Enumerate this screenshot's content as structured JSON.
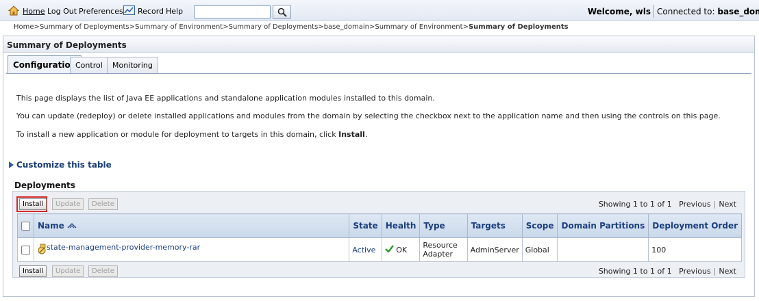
{
  "toolbar": {
    "home": "Home",
    "logout": "Log Out",
    "preferences": "Preferences",
    "record": "Record",
    "help": "Help",
    "search_value": "",
    "welcome": "Welcome, wls",
    "connected_label": "Connected to:",
    "domain": "base_domain"
  },
  "breadcrumb": {
    "items": [
      "Home",
      "Summary of Deployments",
      "Summary of Environment",
      "Summary of Deployments",
      "base_domain",
      "Summary of Environment"
    ],
    "separator": ">",
    "current": "Summary of Deployments"
  },
  "panel": {
    "title": "Summary of Deployments",
    "tabs": [
      "Configuration",
      "Control",
      "Monitoring"
    ],
    "active_tab": "Configuration"
  },
  "intro": {
    "line1": "This page displays the list of Java EE applications and standalone application modules installed to this domain.",
    "line2": "You can update (redeploy) or delete installed applications and modules from the domain by selecting the checkbox next to the application name and then using the controls on this page.",
    "line3_prefix": "To install a new application or module for deployment to targets in this domain, click ",
    "line3_bold": "Install",
    "line3_suffix": "."
  },
  "customize": "Customize this table",
  "deployments": {
    "title": "Deployments",
    "buttons": {
      "install": "Install",
      "update": "Update",
      "delete": "Delete"
    },
    "paging": {
      "showing": "Showing 1 to 1 of 1",
      "previous": "Previous",
      "next": "Next"
    },
    "columns": [
      "Name",
      "State",
      "Health",
      "Type",
      "Targets",
      "Scope",
      "Domain Partitions",
      "Deployment Order"
    ],
    "rows": [
      {
        "name": "state-management-provider-memory-rar",
        "state": "Active",
        "health": "OK",
        "type_line1": "Resource",
        "type_line2": "Adapter",
        "targets": "AdminServer",
        "scope": "Global",
        "partitions": "",
        "order": "100"
      }
    ]
  },
  "colors": {
    "accent": "#1a3f7e",
    "highlight": "#d42a2a",
    "ok": "#2d9a2d"
  }
}
